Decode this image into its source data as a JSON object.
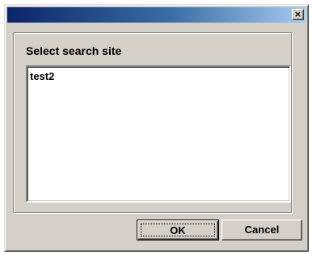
{
  "window": {
    "title": "",
    "close_glyph": "×"
  },
  "group": {
    "label": "Select search site"
  },
  "list": {
    "items": [
      "test2"
    ]
  },
  "buttons": {
    "ok_label": "OK",
    "cancel_label": "Cancel"
  },
  "colors": {
    "face": "#d4d0c8",
    "title_start": "#0a246a",
    "title_end": "#a6caf0"
  },
  "icons": {
    "close": "close-icon"
  }
}
